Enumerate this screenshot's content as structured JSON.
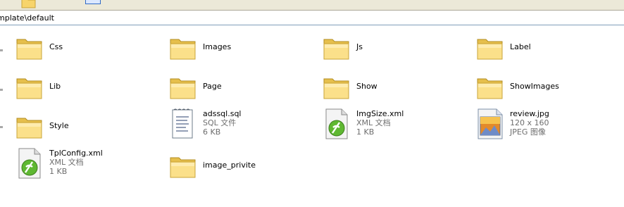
{
  "window": {
    "address_path": "mplate\\default"
  },
  "items": [
    {
      "name": "Css",
      "type": "folder"
    },
    {
      "name": "Images",
      "type": "folder"
    },
    {
      "name": "Js",
      "type": "folder"
    },
    {
      "name": "Label",
      "type": "folder"
    },
    {
      "name": "Lib",
      "type": "folder"
    },
    {
      "name": "Page",
      "type": "folder"
    },
    {
      "name": "Show",
      "type": "folder"
    },
    {
      "name": "ShowImages",
      "type": "folder"
    },
    {
      "name": "Style",
      "type": "folder"
    },
    {
      "name": "adssql.sql",
      "type": "sql-file",
      "kind": "SQL 文件",
      "size": "6 KB"
    },
    {
      "name": "ImgSize.xml",
      "type": "xml-file",
      "kind": "XML 文档",
      "size": "1 KB"
    },
    {
      "name": "review.jpg",
      "type": "jpeg-file",
      "dimensions": "120 x 160",
      "kind": "JPEG 图像"
    },
    {
      "name": "TplConfig.xml",
      "type": "xml-file",
      "kind": "XML 文档",
      "size": "1 KB"
    },
    {
      "name": "image_privite",
      "type": "folder"
    }
  ],
  "icons": {
    "folder": "folder-icon",
    "sql": "sql-file-icon",
    "xml": "xml-file-icon",
    "jpeg": "jpeg-file-icon"
  }
}
